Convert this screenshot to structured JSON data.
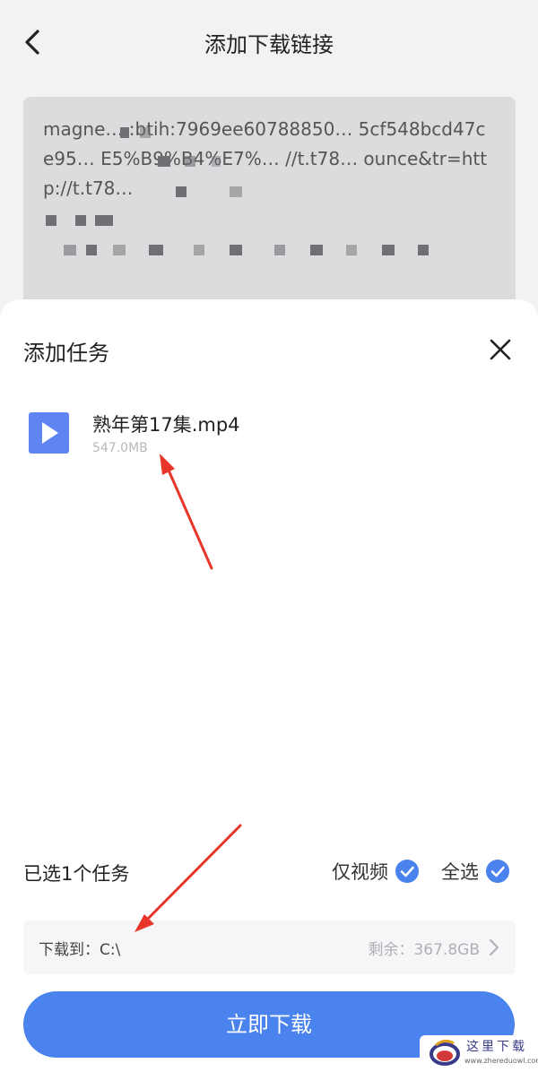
{
  "header": {
    "title": "添加下载链接"
  },
  "link_box": {
    "text": "magne… :btih:7969ee60788850… 5cf548bcd47ce95… E5%B9%B4%E7%… //t.t78… ounce&tr=http://t.t78…"
  },
  "sheet": {
    "title": "添加任务",
    "file": {
      "name": "熟年第17集.mp4",
      "size": "547.0MB"
    },
    "selected_count": "已选1个任务",
    "video_only_label": "仅视频",
    "select_all_label": "全选",
    "path_label": "下载到：C:\\",
    "remaining_label": "剩余：367.8GB",
    "download_button": "立即下载"
  },
  "watermark": {
    "title": "这里下载",
    "url": "www.zhereduowl.com"
  },
  "colors": {
    "accent": "#4a83ee",
    "file_icon": "#5e85f2",
    "arrow": "#e8362a"
  }
}
